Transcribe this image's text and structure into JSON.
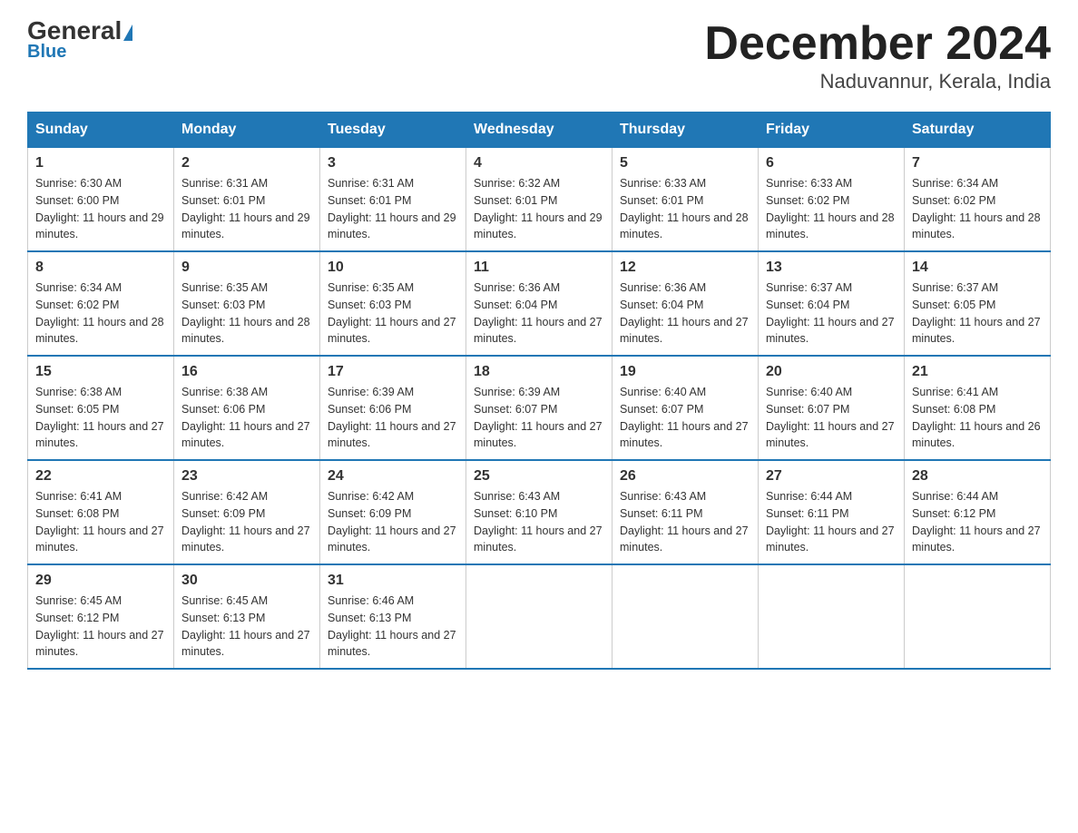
{
  "logo": {
    "text_general": "General",
    "triangle": "▶",
    "text_blue": "Blue"
  },
  "title": "December 2024",
  "subtitle": "Naduvannur, Kerala, India",
  "weekdays": [
    "Sunday",
    "Monday",
    "Tuesday",
    "Wednesday",
    "Thursday",
    "Friday",
    "Saturday"
  ],
  "weeks": [
    [
      {
        "day": "1",
        "sunrise": "6:30 AM",
        "sunset": "6:00 PM",
        "daylight": "11 hours and 29 minutes."
      },
      {
        "day": "2",
        "sunrise": "6:31 AM",
        "sunset": "6:01 PM",
        "daylight": "11 hours and 29 minutes."
      },
      {
        "day": "3",
        "sunrise": "6:31 AM",
        "sunset": "6:01 PM",
        "daylight": "11 hours and 29 minutes."
      },
      {
        "day": "4",
        "sunrise": "6:32 AM",
        "sunset": "6:01 PM",
        "daylight": "11 hours and 29 minutes."
      },
      {
        "day": "5",
        "sunrise": "6:33 AM",
        "sunset": "6:01 PM",
        "daylight": "11 hours and 28 minutes."
      },
      {
        "day": "6",
        "sunrise": "6:33 AM",
        "sunset": "6:02 PM",
        "daylight": "11 hours and 28 minutes."
      },
      {
        "day": "7",
        "sunrise": "6:34 AM",
        "sunset": "6:02 PM",
        "daylight": "11 hours and 28 minutes."
      }
    ],
    [
      {
        "day": "8",
        "sunrise": "6:34 AM",
        "sunset": "6:02 PM",
        "daylight": "11 hours and 28 minutes."
      },
      {
        "day": "9",
        "sunrise": "6:35 AM",
        "sunset": "6:03 PM",
        "daylight": "11 hours and 28 minutes."
      },
      {
        "day": "10",
        "sunrise": "6:35 AM",
        "sunset": "6:03 PM",
        "daylight": "11 hours and 27 minutes."
      },
      {
        "day": "11",
        "sunrise": "6:36 AM",
        "sunset": "6:04 PM",
        "daylight": "11 hours and 27 minutes."
      },
      {
        "day": "12",
        "sunrise": "6:36 AM",
        "sunset": "6:04 PM",
        "daylight": "11 hours and 27 minutes."
      },
      {
        "day": "13",
        "sunrise": "6:37 AM",
        "sunset": "6:04 PM",
        "daylight": "11 hours and 27 minutes."
      },
      {
        "day": "14",
        "sunrise": "6:37 AM",
        "sunset": "6:05 PM",
        "daylight": "11 hours and 27 minutes."
      }
    ],
    [
      {
        "day": "15",
        "sunrise": "6:38 AM",
        "sunset": "6:05 PM",
        "daylight": "11 hours and 27 minutes."
      },
      {
        "day": "16",
        "sunrise": "6:38 AM",
        "sunset": "6:06 PM",
        "daylight": "11 hours and 27 minutes."
      },
      {
        "day": "17",
        "sunrise": "6:39 AM",
        "sunset": "6:06 PM",
        "daylight": "11 hours and 27 minutes."
      },
      {
        "day": "18",
        "sunrise": "6:39 AM",
        "sunset": "6:07 PM",
        "daylight": "11 hours and 27 minutes."
      },
      {
        "day": "19",
        "sunrise": "6:40 AM",
        "sunset": "6:07 PM",
        "daylight": "11 hours and 27 minutes."
      },
      {
        "day": "20",
        "sunrise": "6:40 AM",
        "sunset": "6:07 PM",
        "daylight": "11 hours and 27 minutes."
      },
      {
        "day": "21",
        "sunrise": "6:41 AM",
        "sunset": "6:08 PM",
        "daylight": "11 hours and 26 minutes."
      }
    ],
    [
      {
        "day": "22",
        "sunrise": "6:41 AM",
        "sunset": "6:08 PM",
        "daylight": "11 hours and 27 minutes."
      },
      {
        "day": "23",
        "sunrise": "6:42 AM",
        "sunset": "6:09 PM",
        "daylight": "11 hours and 27 minutes."
      },
      {
        "day": "24",
        "sunrise": "6:42 AM",
        "sunset": "6:09 PM",
        "daylight": "11 hours and 27 minutes."
      },
      {
        "day": "25",
        "sunrise": "6:43 AM",
        "sunset": "6:10 PM",
        "daylight": "11 hours and 27 minutes."
      },
      {
        "day": "26",
        "sunrise": "6:43 AM",
        "sunset": "6:11 PM",
        "daylight": "11 hours and 27 minutes."
      },
      {
        "day": "27",
        "sunrise": "6:44 AM",
        "sunset": "6:11 PM",
        "daylight": "11 hours and 27 minutes."
      },
      {
        "day": "28",
        "sunrise": "6:44 AM",
        "sunset": "6:12 PM",
        "daylight": "11 hours and 27 minutes."
      }
    ],
    [
      {
        "day": "29",
        "sunrise": "6:45 AM",
        "sunset": "6:12 PM",
        "daylight": "11 hours and 27 minutes."
      },
      {
        "day": "30",
        "sunrise": "6:45 AM",
        "sunset": "6:13 PM",
        "daylight": "11 hours and 27 minutes."
      },
      {
        "day": "31",
        "sunrise": "6:46 AM",
        "sunset": "6:13 PM",
        "daylight": "11 hours and 27 minutes."
      },
      null,
      null,
      null,
      null
    ]
  ]
}
